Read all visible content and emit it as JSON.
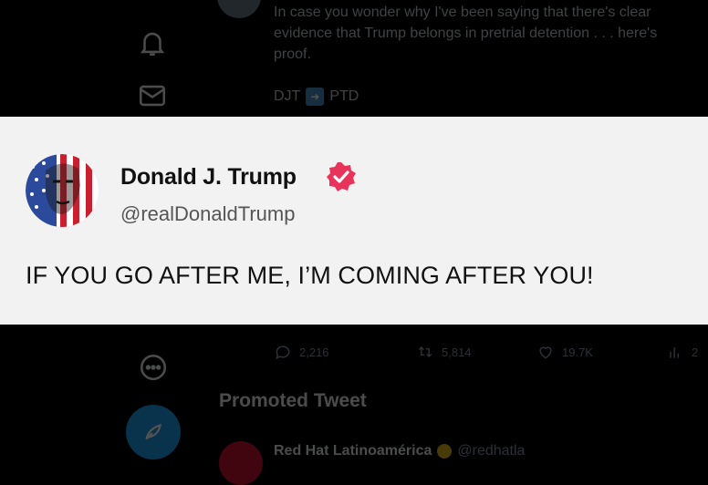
{
  "background": {
    "tweet_text": "In case you wonder why I've been saying that there's clear\nevidence that Trump belongs in pretrial detention . . . here's\nproof.",
    "tags": {
      "left": "DJT",
      "right": "PTD",
      "icon": "arrow-right-icon"
    },
    "actions": {
      "replies": "2,216",
      "retweets": "5,814",
      "likes": "19.7K",
      "views": "2"
    },
    "promoted_label": "Promoted Tweet",
    "advertiser": {
      "name": "Red Hat Latinoamérica",
      "handle": "@redhatla"
    },
    "nav_icons": [
      "bell-icon",
      "mail-icon",
      "more-circle-icon",
      "compose-icon"
    ]
  },
  "card": {
    "name": "Donald J. Trump",
    "handle": "@realDonaldTrump",
    "text": "IF YOU GO AFTER ME, I’M COMING AFTER YOU!",
    "badge_color": "#e8345a",
    "background_color": "#f2f2f3"
  },
  "colors": {
    "page_bg": "#000000",
    "accent": "#1d9bf0"
  }
}
